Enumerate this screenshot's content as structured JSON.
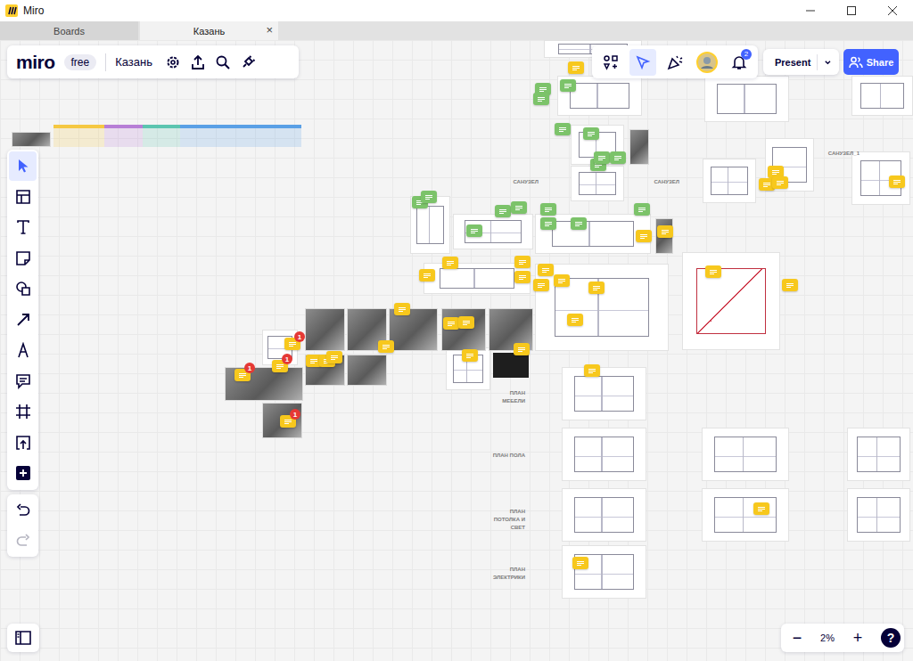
{
  "window": {
    "title": "Miro"
  },
  "tabs": [
    {
      "label": "Boards",
      "selected": false,
      "close": ""
    },
    {
      "label": "Казань",
      "selected": true,
      "close": "×"
    }
  ],
  "board_bar": {
    "logo": "miro",
    "plan": "free",
    "board_name": "Казань"
  },
  "top_tools": [
    {
      "kind": "apps",
      "selected": false
    },
    {
      "kind": "cursor",
      "selected": true
    },
    {
      "kind": "reactions",
      "selected": false
    },
    {
      "kind": "avatar",
      "selected": false
    },
    {
      "kind": "bell",
      "selected": false,
      "badge": "2"
    }
  ],
  "present": "Present",
  "share": "Share",
  "tools": [
    {
      "kind": "select",
      "selected": true
    },
    {
      "kind": "templates",
      "selected": false
    },
    {
      "kind": "text",
      "selected": false
    },
    {
      "kind": "sticky",
      "selected": false
    },
    {
      "kind": "shapes",
      "selected": false
    },
    {
      "kind": "line",
      "selected": false
    },
    {
      "kind": "pen",
      "selected": false
    },
    {
      "kind": "comment",
      "selected": false
    },
    {
      "kind": "frame",
      "selected": false
    },
    {
      "kind": "upload",
      "selected": false
    },
    {
      "kind": "more",
      "selected": false
    }
  ],
  "history": [
    {
      "kind": "undo",
      "disabled": false
    },
    {
      "kind": "redo",
      "disabled": true
    }
  ],
  "zoom": {
    "minus": "−",
    "level": "2%",
    "plus": "+",
    "help": "?"
  },
  "canvas": {
    "strip": [
      {
        "color": "#f5c842"
      },
      {
        "color": "#b77fd6"
      },
      {
        "color": "#5cc5b0"
      },
      {
        "color": "#5aa0e6"
      },
      {
        "color": "#5aa0e6"
      }
    ],
    "labels": [
      "САНУЗЕЛ",
      "САНУЗЕЛ",
      "САНУЗЕЛ_1",
      "ПЛАН МЕБЕЛИ",
      "ПЛАН ПОЛА",
      "ПЛАН ПОТОЛКА И СВЕТ",
      "ПЛАН ЭЛЕКТРИКИ"
    ],
    "comments": [
      {
        "color": "#7cc36a"
      },
      {
        "color": "#7cc36a"
      },
      {
        "color": "#7cc36a"
      },
      {
        "color": "#7cc36a"
      },
      {
        "color": "#7cc36a"
      },
      {
        "color": "#7cc36a"
      },
      {
        "color": "#7cc36a"
      },
      {
        "color": "#7cc36a"
      },
      {
        "color": "#7cc36a"
      },
      {
        "color": "#7cc36a"
      },
      {
        "color": "#7cc36a"
      },
      {
        "color": "#7cc36a"
      },
      {
        "color": "#7cc36a"
      },
      {
        "color": "#7cc36a"
      },
      {
        "color": "#7cc36a"
      },
      {
        "color": "#7cc36a"
      },
      {
        "color": "#7cc36a"
      },
      {
        "color": "#f7c81d"
      },
      {
        "color": "#f7c81d"
      },
      {
        "color": "#f7c81d"
      },
      {
        "color": "#f7c81d"
      },
      {
        "color": "#f7c81d"
      },
      {
        "color": "#f7c81d"
      },
      {
        "color": "#f7c81d"
      },
      {
        "color": "#f7c81d"
      },
      {
        "color": "#f7c81d"
      },
      {
        "color": "#f7c81d"
      },
      {
        "color": "#f7c81d"
      },
      {
        "color": "#f7c81d"
      },
      {
        "color": "#f7c81d"
      },
      {
        "color": "#f7c81d"
      },
      {
        "color": "#f7c81d"
      },
      {
        "color": "#f7c81d"
      },
      {
        "color": "#f7c81d"
      },
      {
        "color": "#f7c81d"
      },
      {
        "color": "#f7c81d"
      },
      {
        "color": "#f7c81d"
      },
      {
        "color": "#f7c81d"
      },
      {
        "color": "#f7c81d"
      },
      {
        "color": "#f7c81d",
        "badge": "1"
      },
      {
        "color": "#f7c81d",
        "badge": "1"
      },
      {
        "color": "#f7c81d"
      },
      {
        "color": "#f7c81d"
      },
      {
        "color": "#f7c81d"
      },
      {
        "color": "#f7c81d"
      },
      {
        "color": "#f7c81d"
      },
      {
        "color": "#f7c81d"
      },
      {
        "color": "#f7c81d",
        "badge": "1"
      },
      {
        "color": "#f7c81d",
        "badge": "1"
      },
      {
        "color": "#f7c81d"
      },
      {
        "color": "#f7c81d"
      }
    ]
  }
}
